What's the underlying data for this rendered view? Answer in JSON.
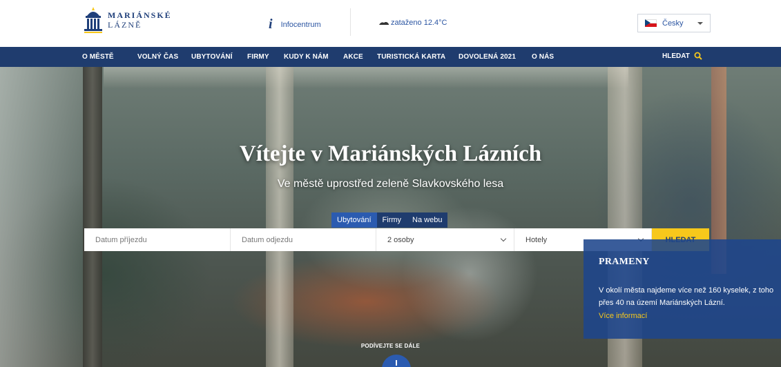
{
  "header": {
    "logo_line1": "MARIÁNSKÉ",
    "logo_line2": "LÁZNĚ",
    "info_label": "Infocentrum",
    "weather_label": "zataženo 12.4°C",
    "language": "Česky"
  },
  "nav": {
    "items": [
      "O MĚSTĚ",
      "VOLNÝ ČAS",
      "UBYTOVÁNÍ",
      "FIRMY",
      "KUDY K NÁM",
      "AKCE",
      "TURISTICKÁ KARTA",
      "DOVOLENÁ 2021",
      "O NÁS"
    ],
    "search_label": "HLEDAT"
  },
  "hero": {
    "title": "Vítejte v Mariánských Lázních",
    "subtitle": "Ve městě uprostřed zeleně Slavkovského lesa"
  },
  "booking": {
    "tabs": [
      "Ubytování",
      "Firmy",
      "Na webu"
    ],
    "active_tab": "Ubytování",
    "arrival_placeholder": "Datum příjezdu",
    "departure_placeholder": "Datum odjezdu",
    "guests_value": "2 osoby",
    "type_value": "Hotely",
    "submit_label": "HLEDAT"
  },
  "prameny": {
    "title": "PRAMENY",
    "text": "V okolí města najdeme více než 160 kyselek, z toho přes 40 na území Mariánských Lázní.",
    "link": "Více informací"
  },
  "scroll_hint": "PODÍVEJTE SE DÁLE",
  "colors": {
    "nav_bg": "#1f3c6e",
    "accent": "#f7c81b",
    "active_tab": "#2b5bb0",
    "link": "#2b55a2"
  },
  "icons": {
    "info": "info-icon",
    "weather": "cloud-icon",
    "search": "magnifier-icon",
    "flag": "czech-flag-icon"
  }
}
